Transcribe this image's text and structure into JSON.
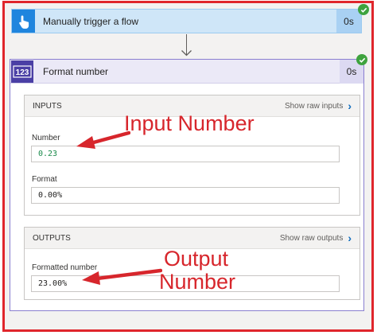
{
  "trigger": {
    "title": "Manually trigger a flow",
    "duration": "0s",
    "icon": "hand-pointer-icon",
    "color": "#1f85de"
  },
  "action": {
    "title": "Format number",
    "duration": "0s",
    "icon_text": "123",
    "color": "#4a3fa5",
    "status": "success"
  },
  "inputs": {
    "heading": "INPUTS",
    "raw_link": "Show raw inputs",
    "number_label": "Number",
    "number_value": "0.23",
    "format_label": "Format",
    "format_value": "0.00%"
  },
  "outputs": {
    "heading": "OUTPUTS",
    "raw_link": "Show raw outputs",
    "formatted_label": "Formatted number",
    "formatted_value": "23.00%"
  },
  "annotations": {
    "input_callout": "Input Number",
    "output_callout_line1": "Output",
    "output_callout_line2": "Number",
    "color": "#d7262c"
  }
}
